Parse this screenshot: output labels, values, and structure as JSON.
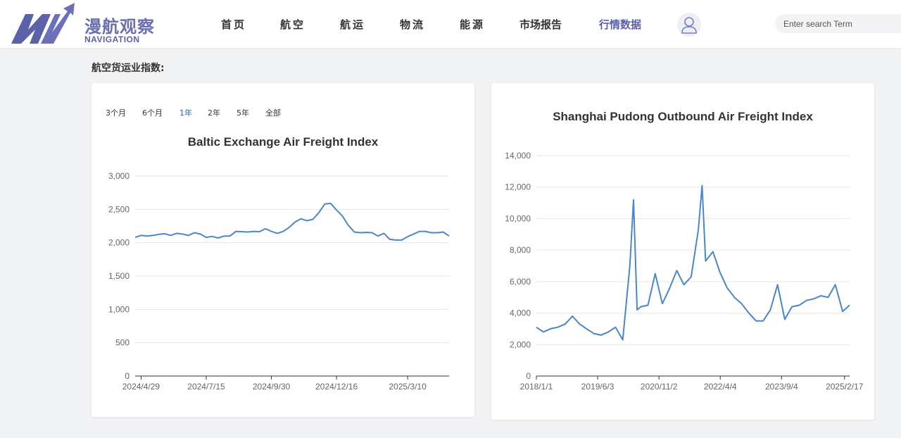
{
  "header": {
    "logo_cn": "漫航观察",
    "logo_en": "NAVIGATION",
    "nav": [
      {
        "label": "首页",
        "active": false
      },
      {
        "label": "航空",
        "active": false
      },
      {
        "label": "航运",
        "active": false
      },
      {
        "label": "物流",
        "active": false
      },
      {
        "label": "能源",
        "active": false
      },
      {
        "label": "市场报告",
        "active": false
      },
      {
        "label": "行情数据",
        "active": true
      }
    ],
    "search_placeholder": "Enter search Term"
  },
  "section_title": "航空货运业指数:",
  "baltic": {
    "ranges": [
      {
        "label": "3个月",
        "active": false
      },
      {
        "label": "6个月",
        "active": false
      },
      {
        "label": "1年",
        "active": true
      },
      {
        "label": "2年",
        "active": false
      },
      {
        "label": "5年",
        "active": false
      },
      {
        "label": "全部",
        "active": false
      }
    ]
  },
  "chart_data": [
    {
      "type": "line",
      "title": "Baltic Exchange Air Freight Index",
      "xlabel": "",
      "ylabel": "",
      "ylim": [
        0,
        3000
      ],
      "yticks": [
        "3,000",
        "2,500",
        "2,000",
        "1,500",
        "1,000",
        "500",
        "0"
      ],
      "xticks": [
        "2024/4/29",
        "2024/7/15",
        "2024/9/30",
        "2024/12/16",
        "2025/3/10"
      ],
      "grid": true,
      "color": "#4a86c8",
      "series": [
        {
          "x": [
            "2024/4/22",
            "2024/4/29",
            "2024/5/6",
            "2024/5/13",
            "2024/5/20",
            "2024/5/27",
            "2024/6/3",
            "2024/6/10",
            "2024/6/17",
            "2024/6/24",
            "2024/7/1",
            "2024/7/8",
            "2024/7/15",
            "2024/7/22",
            "2024/7/29",
            "2024/8/5",
            "2024/8/12",
            "2024/8/19",
            "2024/8/26",
            "2024/9/2",
            "2024/9/9",
            "2024/9/16",
            "2024/9/23",
            "2024/9/30",
            "2024/10/7",
            "2024/10/14",
            "2024/10/21",
            "2024/10/28",
            "2024/11/4",
            "2024/11/11",
            "2024/11/18",
            "2024/11/25",
            "2024/12/2",
            "2024/12/9",
            "2024/12/16",
            "2024/12/23",
            "2024/12/30",
            "2025/1/6",
            "2025/1/13",
            "2025/1/20",
            "2025/1/27",
            "2025/2/3",
            "2025/2/10",
            "2025/2/17",
            "2025/2/24",
            "2025/3/3",
            "2025/3/10",
            "2025/3/17",
            "2025/3/24",
            "2025/3/31",
            "2025/4/7",
            "2025/4/14",
            "2025/4/21",
            "2025/4/28"
          ],
          "values": [
            2080,
            2110,
            2100,
            2110,
            2125,
            2135,
            2110,
            2140,
            2130,
            2110,
            2150,
            2130,
            2080,
            2095,
            2070,
            2100,
            2100,
            2170,
            2165,
            2160,
            2170,
            2165,
            2210,
            2170,
            2140,
            2170,
            2230,
            2310,
            2360,
            2330,
            2350,
            2450,
            2580,
            2590,
            2490,
            2400,
            2260,
            2160,
            2150,
            2155,
            2150,
            2100,
            2140,
            2050,
            2040,
            2040,
            2090,
            2130,
            2170,
            2170,
            2150,
            2150,
            2160,
            2100
          ]
        }
      ]
    },
    {
      "type": "line",
      "title": "Shanghai Pudong Outbound Air Freight Index",
      "xlabel": "",
      "ylabel": "",
      "ylim": [
        0,
        14000
      ],
      "yticks": [
        "14,000",
        "12,000",
        "10,000",
        "8,000",
        "6,000",
        "4,000",
        "2,000",
        "0"
      ],
      "xticks": [
        "2018/1/1",
        "2019/6/3",
        "2020/11/2",
        "2022/4/4",
        "2023/9/4",
        "2025/2/17"
      ],
      "grid": true,
      "color": "#4a86c8",
      "series": [
        {
          "x": [
            "2018/1",
            "2018/3",
            "2018/5",
            "2018/7",
            "2018/9",
            "2018/11",
            "2019/1",
            "2019/3",
            "2019/5",
            "2019/7",
            "2019/9",
            "2019/11",
            "2020/1",
            "2020/3",
            "2020/4",
            "2020/5",
            "2020/6",
            "2020/8",
            "2020/10",
            "2020/12",
            "2021/2",
            "2021/4",
            "2021/6",
            "2021/8",
            "2021/10",
            "2021/11",
            "2021/12",
            "2022/2",
            "2022/4",
            "2022/6",
            "2022/8",
            "2022/10",
            "2022/12",
            "2023/2",
            "2023/4",
            "2023/6",
            "2023/8",
            "2023/10",
            "2023/12",
            "2024/2",
            "2024/4",
            "2024/6",
            "2024/8",
            "2024/10",
            "2024/12",
            "2025/2",
            "2025/4"
          ],
          "values": [
            3100,
            2800,
            3000,
            3100,
            3300,
            3800,
            3300,
            3000,
            2700,
            2600,
            2800,
            3100,
            2300,
            7000,
            11200,
            4200,
            4400,
            4500,
            6500,
            4600,
            5600,
            6700,
            5800,
            6300,
            9300,
            12100,
            7300,
            7900,
            6600,
            5600,
            5000,
            4600,
            4000,
            3500,
            3500,
            4200,
            5800,
            3600,
            4400,
            4500,
            4800,
            4900,
            5100,
            5000,
            5800,
            4100,
            4500
          ]
        }
      ]
    }
  ]
}
